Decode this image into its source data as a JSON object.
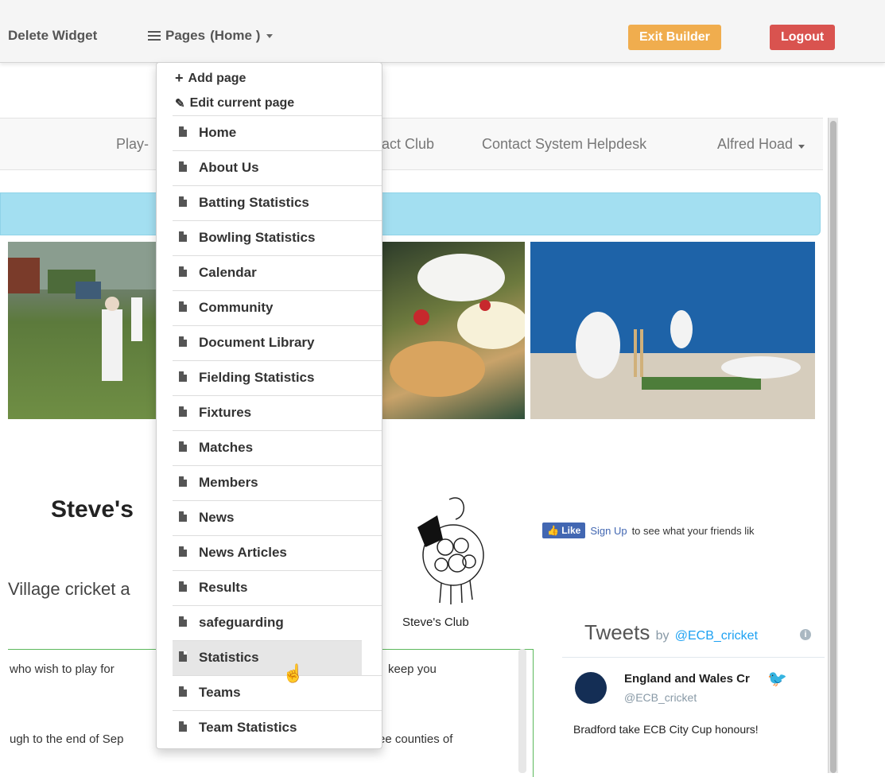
{
  "topbar": {
    "delete_widget": "Delete Widget",
    "pages_label": "Pages",
    "pages_current": "(Home )",
    "exit_builder": "Exit Builder",
    "logout": "Logout"
  },
  "site_nav": {
    "items": [
      "Play-",
      "act Club",
      "Contact System Helpdesk",
      "Alfred Hoad"
    ]
  },
  "main": {
    "club_title": "Steve's",
    "tagline": "Village cricket a",
    "logo_caption": "Steve's Club",
    "body_lines": [
      "who wish to play for",
      "keep you",
      "ugh to the end of Sep",
      "ee counties of"
    ]
  },
  "facebook": {
    "like_label": "Like",
    "signup_link": "Sign Up",
    "signup_text": "to see what your friends lik"
  },
  "tweets": {
    "title": "Tweets",
    "by": "by",
    "handle": "@ECB_cricket",
    "author_name": "England and Wales Cr",
    "author_handle": "@ECB_cricket",
    "text": "Bradford take ECB City Cup honours!"
  },
  "pages_menu": {
    "add_page": "Add page",
    "edit_current_page": "Edit current page",
    "pages": [
      "Home",
      "About Us",
      "Batting Statistics",
      "Bowling Statistics",
      "Calendar",
      "Community",
      "Document Library",
      "Fielding Statistics",
      "Fixtures",
      "Matches",
      "Members",
      "News",
      "News Articles",
      "Results",
      "safeguarding",
      "Statistics",
      "Teams",
      "Team Statistics"
    ],
    "active_index": 15
  },
  "colors": {
    "exit_builder": "#f0ad4e",
    "logout": "#d9534f",
    "alert_bar": "#a3dff1",
    "twitter_blue": "#1da1f2",
    "facebook_blue": "#4267b2"
  }
}
